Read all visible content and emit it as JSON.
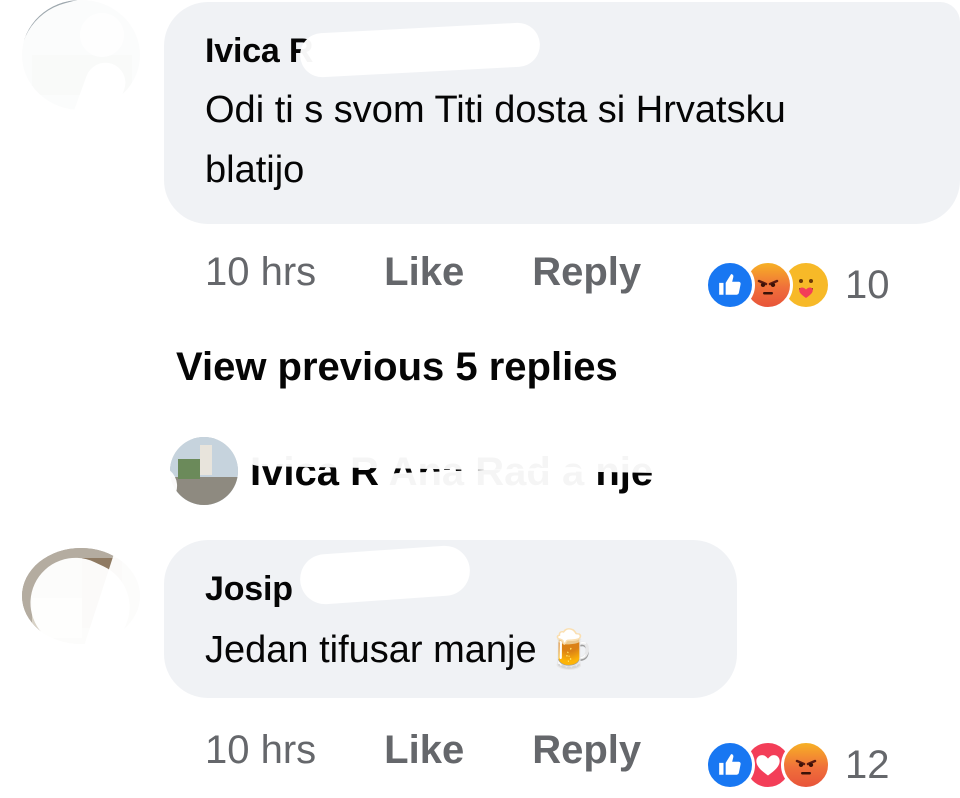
{
  "comments": [
    {
      "author": "Ivica R",
      "text": "Odi ti s svom Titi dosta si Hrvatsku\nblatijo",
      "time": "10 hrs",
      "like_label": "Like",
      "reply_label": "Reply",
      "reactions": [
        "like-icon",
        "angry-icon",
        "care-icon"
      ],
      "reaction_count": "10"
    },
    {
      "author": "Josip",
      "text": "Jedan tifusar manje 🍺",
      "time": "10 hrs",
      "like_label": "Like",
      "reply_label": "Reply",
      "reactions": [
        "like-icon",
        "love-icon",
        "angry-icon"
      ],
      "reaction_count": "12"
    }
  ],
  "view_previous_label": "View previous 5 replies",
  "collapsed_reply": {
    "text": "Ivica R         Ana Rad          a nje"
  },
  "colors": {
    "bubble": "#f0f2f5",
    "meta": "#65676b",
    "like_blue": "#1877f2",
    "love_red": "#f33e58",
    "angry_orange": "#f0703a"
  }
}
